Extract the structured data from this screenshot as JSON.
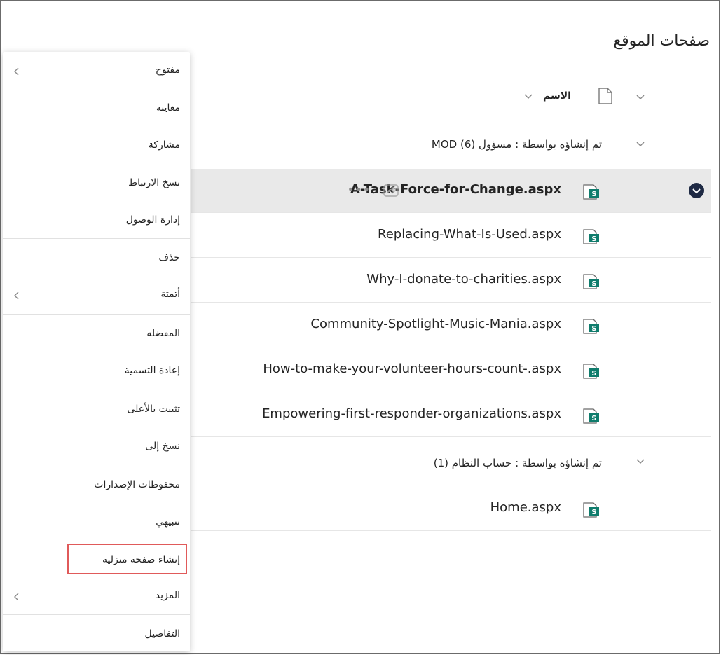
{
  "page_title": "صفحات الموقع",
  "column_header": {
    "name_label": "الاسم"
  },
  "groups": [
    {
      "label": "تم إنشاؤه بواسطة :  مسؤول MOD (6)"
    },
    {
      "label": "تم إنشاؤه بواسطة : حساب النظام (1)"
    }
  ],
  "files_group1": [
    {
      "name": "A-Task-Force-for-Change.aspx",
      "selected": true
    },
    {
      "name": "Replacing-What-Is-Used.aspx"
    },
    {
      "name": "Why-I-donate-to-charities.aspx"
    },
    {
      "name": "Community-Spotlight-Music-Mania.aspx"
    },
    {
      "name": "How-to-make-your-volunteer-hours-count-.aspx"
    },
    {
      "name": "Empowering-first-responder-organizations.aspx"
    }
  ],
  "files_group2": [
    {
      "name": "Home.aspx"
    }
  ],
  "context_menu": {
    "open": "مفتوح",
    "preview": "معاينة",
    "share": "مشاركة",
    "copy_link": "نسخ الارتباط",
    "manage_access": "إدارة الوصول",
    "delete": "حذف",
    "automate": "أتمتة",
    "favorite": "المفضله",
    "rename": "إعادة التسمية",
    "pin_to_top": "تثبيت بالأعلى",
    "copy_to": "نسخ إلى",
    "version_history": "محفوظات الإصدارات",
    "alert_me": "تنبيهي",
    "make_homepage": "إنشاء صفحة منزلية",
    "more": "المزيد",
    "details": "التفاصيل"
  },
  "colors": {
    "highlight_border": "#e05a5a",
    "selected_row": "#e9e9e9",
    "sharepoint_icon": "#0f7c6c"
  }
}
